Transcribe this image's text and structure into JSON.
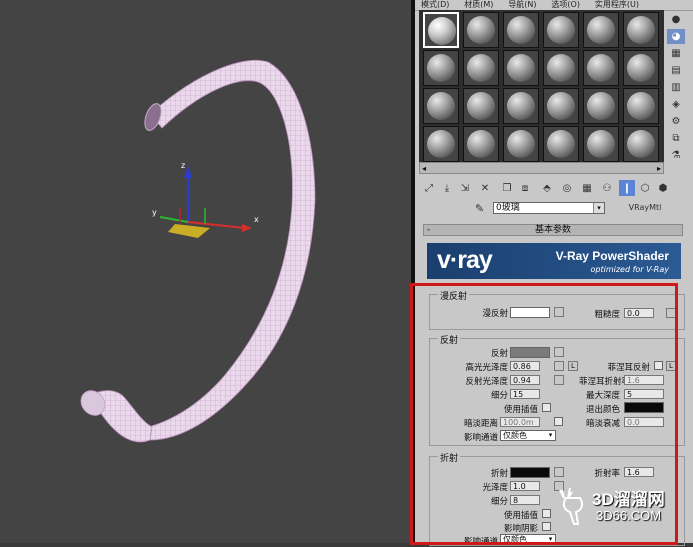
{
  "menu": {
    "items": [
      "模式(D)",
      "材质(M)",
      "导航(N)",
      "选项(O)",
      "实用程序(U)"
    ]
  },
  "material": {
    "name": "0玻璃",
    "type_button": "VRayMtl"
  },
  "rollout": {
    "title": "基本参数",
    "collapse": "-"
  },
  "banner": {
    "logo": "v·ray",
    "title": "V-Ray PowerShader",
    "subtitle": "optimized for V-Ray"
  },
  "diffuse": {
    "title": "漫反射",
    "diffuse_label": "漫反射",
    "roughness_label": "粗糙度",
    "roughness_value": "0.0",
    "diffuse_color": "#ffffff"
  },
  "reflection": {
    "title": "反射",
    "reflect_label": "反射",
    "reflect_color": "#7a7a7a",
    "hilight_gloss_label": "高光光泽度",
    "hilight_gloss_value": "0.86",
    "lock_label": "L",
    "fresnel_label": "菲涅耳反射",
    "fresnel_lock": "L",
    "refl_gloss_label": "反射光泽度",
    "refl_gloss_value": "0.94",
    "fresnel_ior_label": "菲涅耳折射率",
    "fresnel_ior_value": "1.6",
    "subdivs_label": "细分",
    "subdivs_value": "15",
    "max_depth_label": "最大深度",
    "max_depth_value": "5",
    "use_interp_label": "使用插值",
    "exit_color_label": "退出颜色",
    "exit_color": "#0a0a0a",
    "dim_dist_label": "暗淡距离",
    "dim_dist_value": "100.0m",
    "dim_falloff_label": "暗淡衰减",
    "dim_falloff_value": "0.0",
    "affect_channels_label": "影响通道",
    "affect_channels_value": "仅颜色"
  },
  "refraction": {
    "title": "折射",
    "refract_label": "折射",
    "refract_color": "#0a0a0a",
    "ior_label": "折射率",
    "ior_value": "1.6",
    "gloss_label": "光泽度",
    "gloss_value": "1.0",
    "subdivs_label": "细分",
    "subdivs_value": "8",
    "use_interp_label": "使用插值",
    "affect_shadows_label": "影响阴影",
    "affect_channels_label": "影响通道",
    "affect_channels_value": "仅颜色"
  },
  "watermark": {
    "line1": "3D溜溜网",
    "line2": "3D66.COM"
  },
  "colors": {
    "highlight_box": "#d01818",
    "vray_banner": "#244f85",
    "active_button": "#5b84d6"
  }
}
